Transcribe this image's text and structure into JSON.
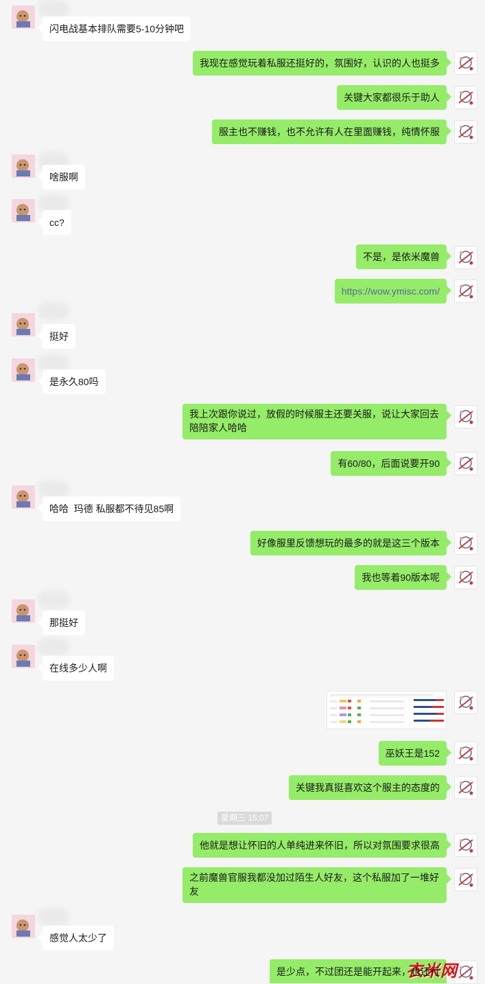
{
  "messages": {
    "m1": "闪电战基本排队需要5-10分钟吧",
    "m2": "我现在感觉玩着私服还挺好的，氛围好，认识的人也挺多",
    "m3": "关键大家都很乐于助人",
    "m4": "服主也不赚钱，也不允许有人在里面赚钱，纯情怀服",
    "m5": "啥服啊",
    "m6": "cc?",
    "m7": "不是，是依米魔兽",
    "m8": "https://wow.ymisc.com/",
    "m9": "挺好",
    "m10": "是永久80吗",
    "m11": "我上次跟你说过，放假的时候服主还要关服，说让大家回去陪陪家人哈哈",
    "m12": "有60/80，后面说要开90",
    "m13": "哈哈  玛德 私服都不待见85啊",
    "m14": "好像服里反馈想玩的最多的就是这三个版本",
    "m15": "我也等着90版本呢",
    "m16": "那挺好",
    "m17": "在线多少人啊",
    "m18": "巫妖王是152",
    "m19": "关键我真挺喜欢这个服主的态度的",
    "m20": "他就是想让怀旧的人单纯进来怀旧，所以对氛围要求很高",
    "m21": "之前魔兽官服我都没加过陌生人好友，这个私服加了一堆好友",
    "m22": "感觉人太少了",
    "m23": "是少点，不过团还是能开起来，也还行"
  },
  "time_divider": "星期三 15:07",
  "watermark": "衣米网",
  "colors": {
    "background": "#f5f5f5",
    "bubble_self": "#95ec69",
    "bubble_other": "#ffffff",
    "link": "#576b95"
  }
}
